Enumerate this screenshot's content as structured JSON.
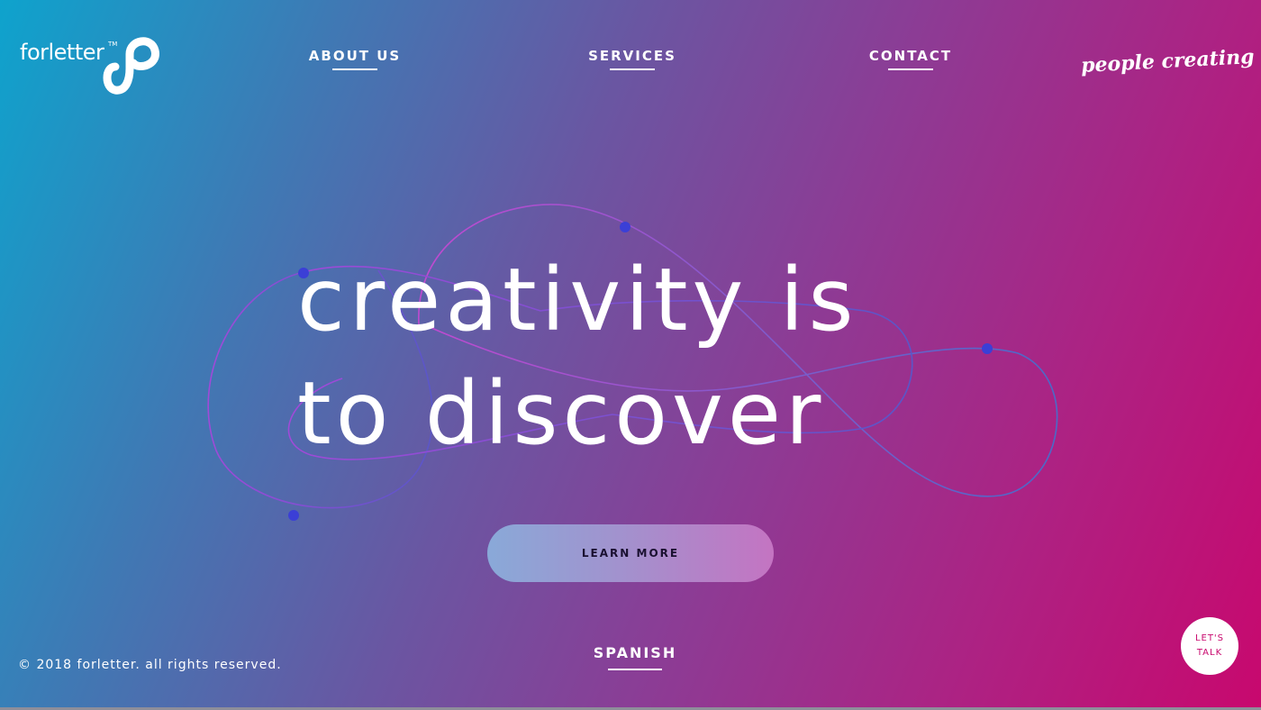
{
  "brand": {
    "name": "forletter",
    "trademark": "TM",
    "tagline": "people creating"
  },
  "nav": {
    "items": [
      {
        "label": "ABOUT US"
      },
      {
        "label": "SERVICES"
      },
      {
        "label": "CONTACT"
      }
    ]
  },
  "hero": {
    "headline_line1": "creativity is",
    "headline_line2": "to discover",
    "cta_label": "LEARN MORE"
  },
  "footer": {
    "copyright": "© 2018 forletter. all rights reserved.",
    "language_label": "SPANISH",
    "chat_label_line1": "LET'S",
    "chat_label_line2": "TALK"
  },
  "colors": {
    "gradient_start": "#0ea3cd",
    "gradient_mid": "#6a56a2",
    "gradient_end": "#c8086e",
    "orbit_dot": "#3b3fd6",
    "chat_text": "#c8086e"
  }
}
